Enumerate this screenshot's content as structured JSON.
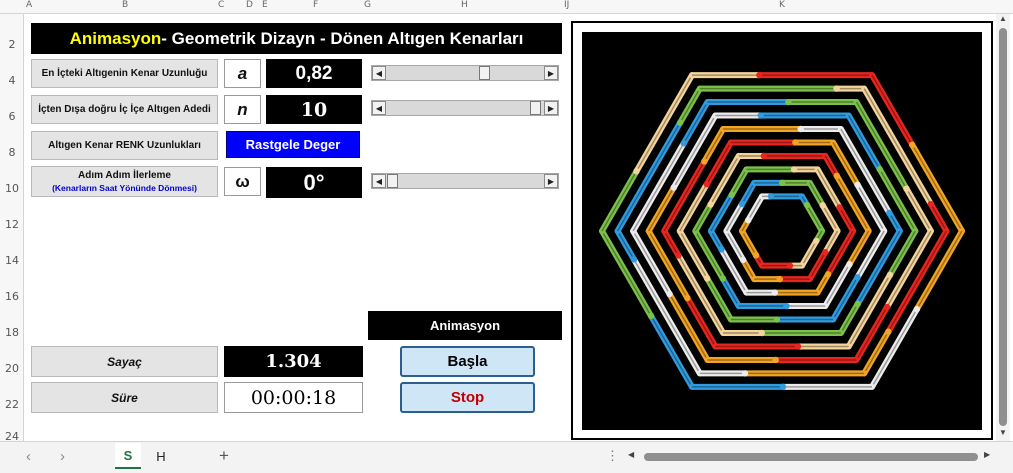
{
  "columns": [
    "A",
    "B",
    "C",
    "D",
    "E",
    "F",
    "G",
    "H",
    "IJ",
    "K"
  ],
  "rows": [
    "2",
    "4",
    "6",
    "8",
    "10",
    "12",
    "14",
    "16",
    "18",
    "20",
    "22",
    "24"
  ],
  "title": {
    "part1": "Animasyon",
    "part2": " - Geometrik Dizayn - Dönen Altıgen Kenarları"
  },
  "controls": {
    "side_label": "En İçteki Altıgenin Kenar Uzunluğu",
    "side_symbol": "a",
    "side_value": "0,82",
    "count_label": "İçten Dışa doğru İç İçe Altıgen Adedi",
    "count_symbol": "n",
    "count_value": "10",
    "color_label": "Altıgen Kenar RENK Uzunlukları",
    "color_button": "Rastgele Deger",
    "step_label_line1": "Adım Adım İlerleme",
    "step_label_line2": "(Kenarların Saat Yönünde Dönmesi)",
    "step_symbol": "ω",
    "step_value": "0°"
  },
  "sliders": {
    "side_level": 0.66,
    "count_level": 0.97,
    "step_level": 0.0
  },
  "counters": {
    "counter_label": "Sayaç",
    "counter_value": "1.304",
    "time_label": "Süre",
    "time_value": "00:00:18"
  },
  "animation": {
    "header": "Animasyon",
    "start_button": "Başla",
    "stop_button": "Stop"
  },
  "tabs": [
    "S",
    "H"
  ],
  "colors": {
    "title_yellow": "#ffff00",
    "button_blue": "#0000ff",
    "stop_red": "#c00000",
    "tab_active": "#217346",
    "palette": [
      "#e8261f",
      "#f2a525",
      "#ececec",
      "#2f9be0",
      "#7cc24a",
      "#f4d49a"
    ]
  },
  "icons": {
    "scroll_left": "chevron-left-icon",
    "scroll_right": "chevron-right-icon",
    "add_sheet": "plus-icon",
    "options": "dots-vertical-icon"
  }
}
